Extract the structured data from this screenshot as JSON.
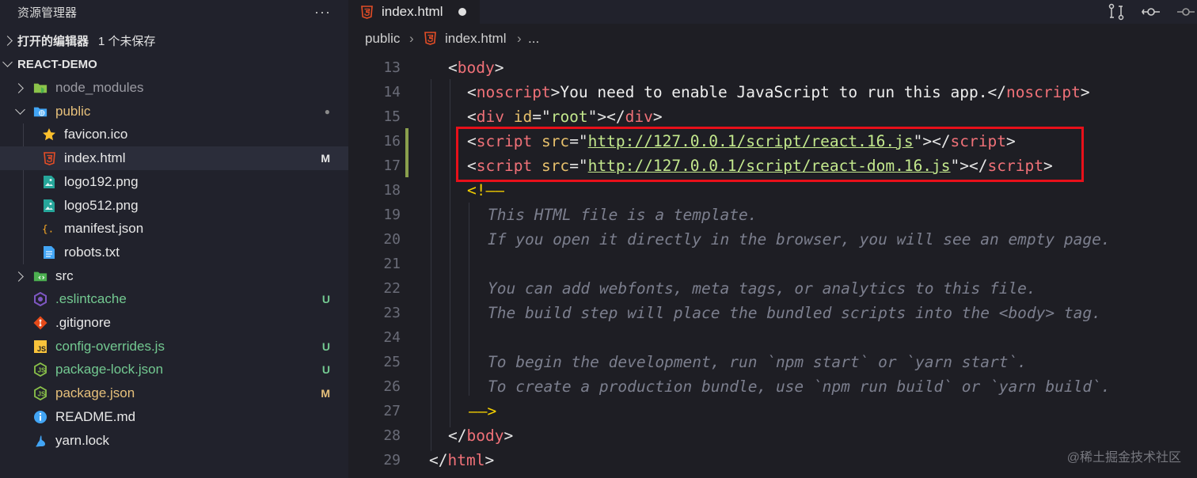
{
  "sidebar": {
    "title": "资源管理器",
    "more": "···",
    "open_editors": "打开的编辑器",
    "unsaved": "1 个未保存",
    "project": "REACT-DEMO",
    "items": [
      {
        "label": "node_modules",
        "color": "#9a9aa2",
        "icon": "folder-node-icon",
        "badge": ""
      },
      {
        "label": "public",
        "color": "#e6c07b",
        "icon": "folder-public-icon",
        "badge": "●"
      },
      {
        "label": "favicon.ico",
        "color": "#e8e8e8",
        "icon": "star-icon",
        "badge": ""
      },
      {
        "label": "index.html",
        "color": "#e8e8e8",
        "icon": "html5-icon",
        "badge": "M"
      },
      {
        "label": "logo192.png",
        "color": "#e8e8e8",
        "icon": "image-icon",
        "badge": ""
      },
      {
        "label": "logo512.png",
        "color": "#e8e8e8",
        "icon": "image-icon",
        "badge": ""
      },
      {
        "label": "manifest.json",
        "color": "#e8e8e8",
        "icon": "json-icon",
        "badge": ""
      },
      {
        "label": "robots.txt",
        "color": "#e8e8e8",
        "icon": "text-file-icon",
        "badge": ""
      },
      {
        "label": "src",
        "color": "#e8e8e8",
        "icon": "folder-src-icon",
        "badge": ""
      },
      {
        "label": ".eslintcache",
        "color": "#73c991",
        "icon": "eslint-icon",
        "badge": "U"
      },
      {
        "label": ".gitignore",
        "color": "#e8e8e8",
        "icon": "git-icon",
        "badge": ""
      },
      {
        "label": "config-overrides.js",
        "color": "#73c991",
        "icon": "js-icon",
        "badge": "U"
      },
      {
        "label": "package-lock.json",
        "color": "#73c991",
        "icon": "nodejs-icon",
        "badge": "U"
      },
      {
        "label": "package.json",
        "color": "#e6c07b",
        "icon": "nodejs-icon",
        "badge": "M"
      },
      {
        "label": "README.md",
        "color": "#e8e8e8",
        "icon": "info-icon",
        "badge": ""
      },
      {
        "label": "yarn.lock",
        "color": "#e8e8e8",
        "icon": "yarn-icon",
        "badge": ""
      }
    ]
  },
  "editor": {
    "tab_label": "index.html",
    "breadcrumb": {
      "folder": "public",
      "sep": "›",
      "file": "index.html",
      "more": "..."
    },
    "lines": [
      {
        "n": "13",
        "parts": [
          [
            "tag-bracket",
            "<"
          ],
          [
            "tag",
            "body"
          ],
          [
            "tag-bracket",
            ">"
          ]
        ]
      },
      {
        "n": "14",
        "parts": [
          [
            "tag-bracket",
            "<"
          ],
          [
            "tag",
            "noscript"
          ],
          [
            "tag-bracket",
            ">"
          ],
          [
            "plain",
            "You need to enable JavaScript to run this app."
          ],
          [
            "tag-bracket",
            "</"
          ],
          [
            "tag",
            "noscript"
          ],
          [
            "tag-bracket",
            ">"
          ]
        ]
      },
      {
        "n": "15",
        "parts": [
          [
            "tag-bracket",
            "<"
          ],
          [
            "tag",
            "div"
          ],
          [
            "plain",
            " "
          ],
          [
            "attr",
            "id"
          ],
          [
            "punc",
            "=\""
          ],
          [
            "str",
            "root"
          ],
          [
            "punc",
            "\">"
          ],
          [
            "tag-bracket",
            "</"
          ],
          [
            "tag",
            "div"
          ],
          [
            "tag-bracket",
            ">"
          ]
        ]
      },
      {
        "n": "16",
        "parts": [
          [
            "tag-bracket",
            "<"
          ],
          [
            "tag",
            "script"
          ],
          [
            "plain",
            " "
          ],
          [
            "attr",
            "src"
          ],
          [
            "punc",
            "=\""
          ],
          [
            "url",
            "http://127.0.0.1/script/react.16.js"
          ],
          [
            "punc",
            "\">"
          ],
          [
            "tag-bracket",
            "</"
          ],
          [
            "tag",
            "script"
          ],
          [
            "tag-bracket",
            ">"
          ]
        ]
      },
      {
        "n": "17",
        "parts": [
          [
            "tag-bracket",
            "<"
          ],
          [
            "tag",
            "script"
          ],
          [
            "plain",
            " "
          ],
          [
            "attr",
            "src"
          ],
          [
            "punc",
            "=\""
          ],
          [
            "url",
            "http://127.0.0.1/script/react-dom.16.js"
          ],
          [
            "punc",
            "\">"
          ],
          [
            "tag-bracket",
            "</"
          ],
          [
            "tag",
            "script"
          ],
          [
            "tag-bracket",
            ">"
          ]
        ]
      },
      {
        "n": "18",
        "parts": [
          [
            "cmt-mark",
            "<!——"
          ]
        ]
      },
      {
        "n": "19",
        "parts": [
          [
            "cmt",
            "This HTML file is a template."
          ]
        ]
      },
      {
        "n": "20",
        "parts": [
          [
            "cmt",
            "If you open it directly in the browser, you will see an empty page."
          ]
        ]
      },
      {
        "n": "21",
        "parts": []
      },
      {
        "n": "22",
        "parts": [
          [
            "cmt",
            "You can add webfonts, meta tags, or analytics to this file."
          ]
        ]
      },
      {
        "n": "23",
        "parts": [
          [
            "cmt",
            "The build step will place the bundled scripts into the <body> tag."
          ]
        ]
      },
      {
        "n": "24",
        "parts": []
      },
      {
        "n": "25",
        "parts": [
          [
            "cmt",
            "To begin the development, run `npm start` or `yarn start`."
          ]
        ]
      },
      {
        "n": "26",
        "parts": [
          [
            "cmt",
            "To create a production bundle, use `npm run build` or `yarn build`."
          ]
        ]
      },
      {
        "n": "27",
        "parts": [
          [
            "cmt-mark",
            "——>"
          ]
        ]
      },
      {
        "n": "28",
        "parts": [
          [
            "tag-bracket",
            "</"
          ],
          [
            "tag",
            "body"
          ],
          [
            "tag-bracket",
            ">"
          ]
        ]
      },
      {
        "n": "29",
        "parts": [
          [
            "tag-bracket",
            "</"
          ],
          [
            "tag",
            "html"
          ],
          [
            "tag-bracket",
            ">"
          ]
        ]
      }
    ]
  },
  "watermark": "@稀土掘金技术社区"
}
